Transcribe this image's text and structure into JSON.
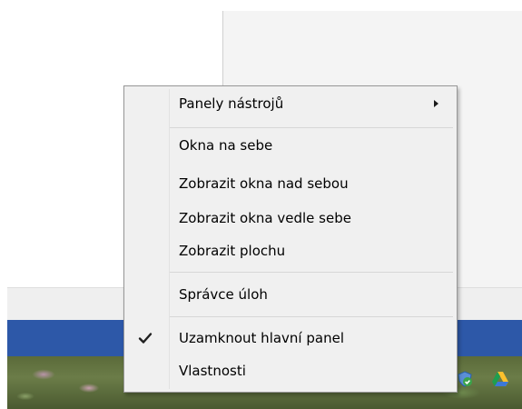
{
  "context_menu": {
    "items": [
      {
        "label": "Panely nástrojů",
        "has_submenu": true
      },
      {
        "label": "Okna na sebe"
      },
      {
        "label": "Zobrazit okna nad sebou"
      },
      {
        "label": "Zobrazit okna vedle sebe"
      },
      {
        "label": "Zobrazit plochu"
      },
      {
        "label": "Správce úloh"
      },
      {
        "label": "Uzamknout hlavní panel",
        "checked": true,
        "icon": "checkmark-icon"
      },
      {
        "label": "Vlastnosti"
      }
    ]
  },
  "tray": {
    "icons": [
      "shield-check-icon",
      "google-drive-icon"
    ]
  },
  "colors": {
    "taskbar": "#2d58a8",
    "menu_background": "#f0f0f0",
    "menu_border": "#979797"
  }
}
